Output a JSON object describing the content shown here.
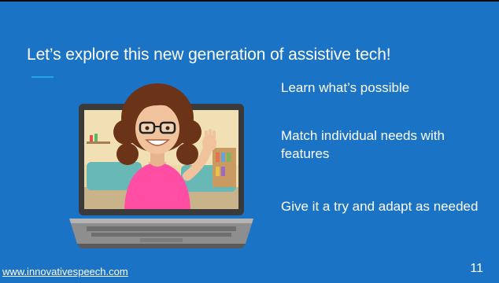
{
  "slide": {
    "title": "Let’s explore this new generation of assistive tech!",
    "bullets": [
      {
        "text": "Learn what’s possible"
      },
      {
        "text": "Match individual needs with features"
      },
      {
        "text": "Give it a try and adapt as needed"
      }
    ],
    "footer_link": "www.innovativespeech.com",
    "slide_number": "11"
  },
  "colors": {
    "background": "#1a73c4",
    "accent": "#22a5ea",
    "text": "#ffffff"
  },
  "illustration": {
    "icon": "laptop-with-avatar-icon"
  }
}
